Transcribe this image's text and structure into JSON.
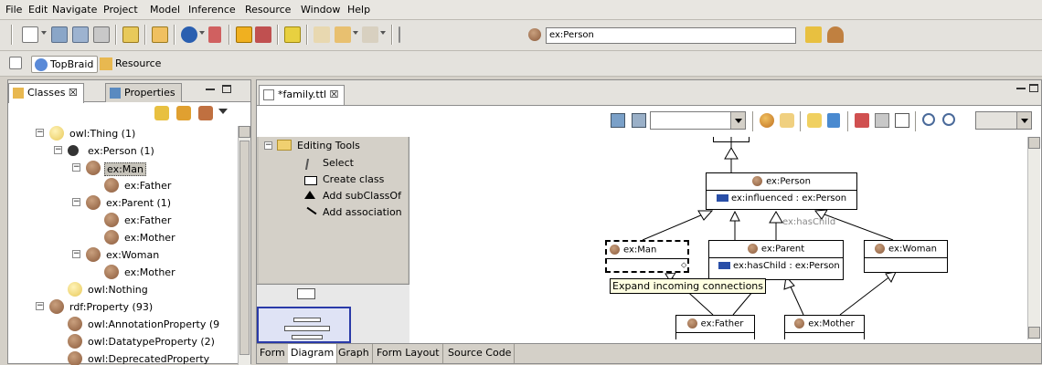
{
  "menu": [
    "File",
    "Edit",
    "Navigate",
    "Project",
    "Model",
    "Inference",
    "Resource",
    "Window",
    "Help"
  ],
  "toolbar": {
    "address_value": "ex:Person"
  },
  "perspectives": [
    {
      "label": "TopBraid"
    },
    {
      "label": "Resource"
    }
  ],
  "left_view": {
    "tabs": [
      {
        "label": "Classes ☒"
      },
      {
        "label": "Properties"
      }
    ],
    "tree": [
      {
        "label": "owl:Thing  (1)",
        "depth": 0,
        "expander": "−",
        "icon": "yellow"
      },
      {
        "label": "ex:Person  (1)",
        "depth": 1,
        "expander": "−",
        "icon": "person"
      },
      {
        "label": "ex:Man",
        "depth": 2,
        "expander": "−",
        "icon": "brown",
        "selected": true
      },
      {
        "label": "ex:Father",
        "depth": 3,
        "expander": "",
        "icon": "brown"
      },
      {
        "label": "ex:Parent  (1)",
        "depth": 2,
        "expander": "−",
        "icon": "brown"
      },
      {
        "label": "ex:Father",
        "depth": 3,
        "expander": "",
        "icon": "brown"
      },
      {
        "label": "ex:Mother",
        "depth": 3,
        "expander": "",
        "icon": "brown"
      },
      {
        "label": "ex:Woman",
        "depth": 2,
        "expander": "−",
        "icon": "brown"
      },
      {
        "label": "ex:Mother",
        "depth": 3,
        "expander": "",
        "icon": "brown"
      },
      {
        "label": "owl:Nothing",
        "depth": 1,
        "expander": "",
        "icon": "yellow"
      },
      {
        "label": "rdf:Property  (93)",
        "depth": 0,
        "expander": "−",
        "icon": "brown"
      },
      {
        "label": "owl:AnnotationProperty  (9",
        "depth": 1,
        "expander": "",
        "icon": "brown"
      },
      {
        "label": "owl:DatatypeProperty  (2)",
        "depth": 1,
        "expander": "",
        "icon": "brown"
      },
      {
        "label": "owl:DeprecatedProperty",
        "depth": 1,
        "expander": "",
        "icon": "brown"
      }
    ]
  },
  "editor": {
    "tab_label": "*family.ttl ☒",
    "palette": {
      "title": "Editing Tools",
      "items": [
        "Select",
        "Create class",
        "Add subClassOf",
        "Add association"
      ]
    },
    "nodes": {
      "person": {
        "title": "ex:Person",
        "prop": "ex:influenced : ex:Person"
      },
      "man": {
        "title": "ex:Man"
      },
      "parent": {
        "title": "ex:Parent",
        "prop": "ex:hasChild : ex:Person"
      },
      "woman": {
        "title": "ex:Woman"
      },
      "father": {
        "title": "ex:Father"
      },
      "mother": {
        "title": "ex:Mother"
      }
    },
    "edge_label": "ex:hasChild",
    "tooltip": "Expand incoming connections",
    "bottom_tabs": [
      "Form",
      "Diagram",
      "Graph",
      "Form Layout",
      "Source Code"
    ],
    "active_bottom_tab": "Diagram"
  }
}
